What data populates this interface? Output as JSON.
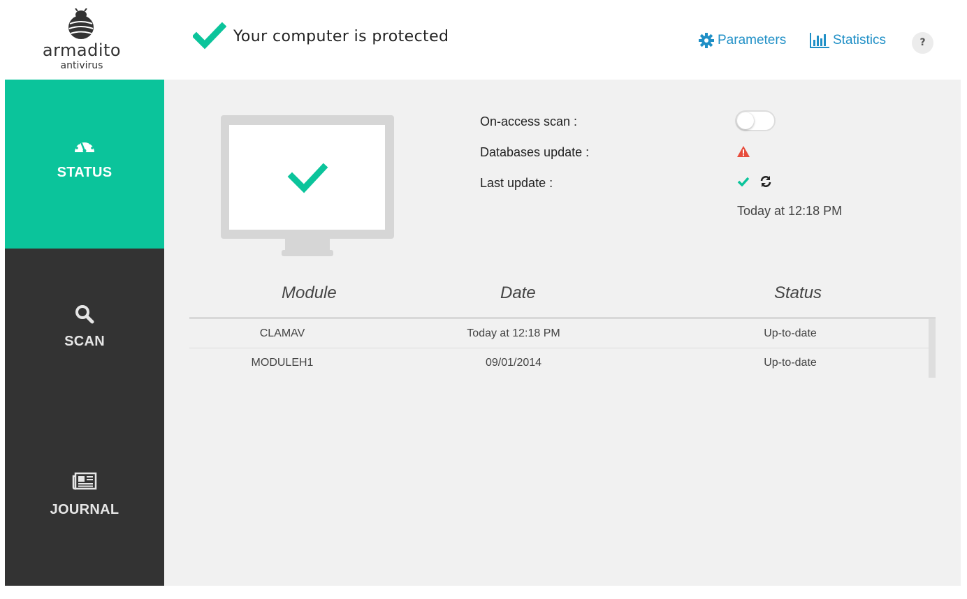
{
  "app": {
    "logo_name": "armadito",
    "logo_sub": "antivirus"
  },
  "header": {
    "status_text": "Your computer is protected",
    "parameters_label": "Parameters",
    "statistics_label": "Statistics",
    "help_label": "?"
  },
  "sidebar": {
    "items": [
      {
        "label": "STATUS",
        "icon": "gauge-icon",
        "active": true
      },
      {
        "label": "SCAN",
        "icon": "search-icon",
        "active": false
      },
      {
        "label": "JOURNAL",
        "icon": "newspaper-icon",
        "active": false
      }
    ]
  },
  "status": {
    "on_access_label": "On-access scan :",
    "on_access_enabled": false,
    "db_update_label": "Databases update :",
    "db_update_state": "warning-icon",
    "last_update_label": "Last update :",
    "last_update_value": "Today at 12:18 PM"
  },
  "modules": {
    "columns": [
      "Module",
      "Date",
      "Status"
    ],
    "rows": [
      {
        "module": "CLAMAV",
        "date": "Today at 12:18 PM",
        "status": "Up-to-date"
      },
      {
        "module": "MODULEH1",
        "date": "09/01/2014",
        "status": "Up-to-date"
      }
    ]
  },
  "colors": {
    "accent": "#0bc49b",
    "sidebar": "#333333",
    "link": "#1f8fc6",
    "warning": "#e74c3c"
  }
}
